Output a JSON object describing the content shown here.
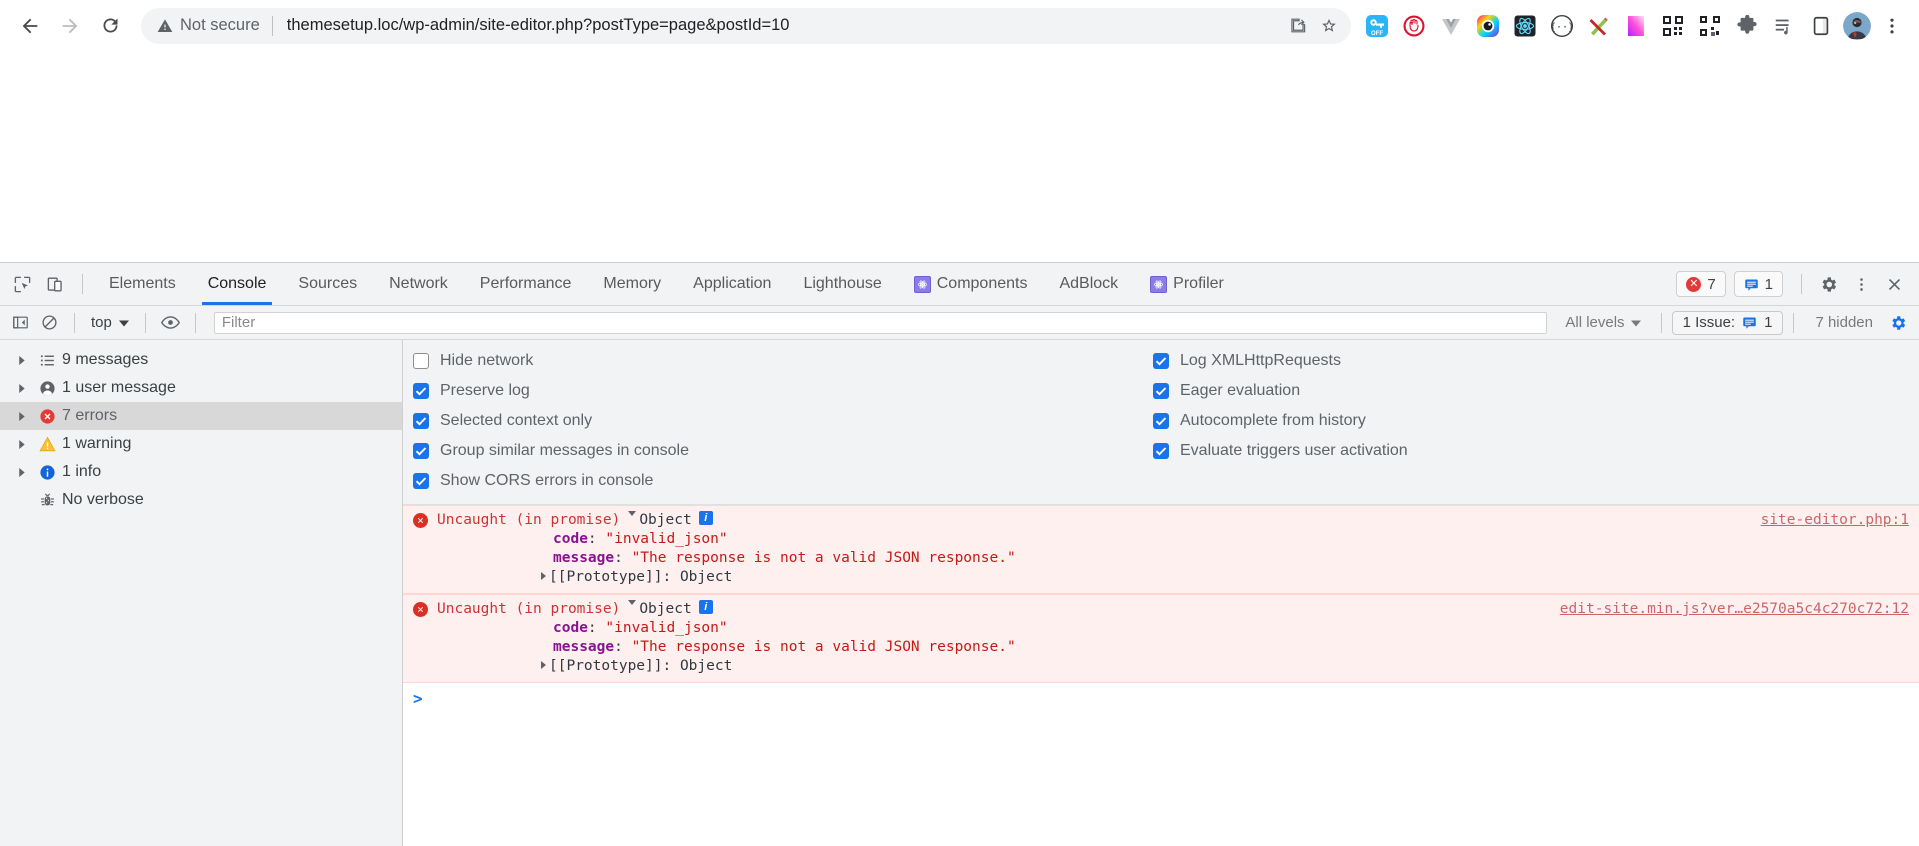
{
  "browser": {
    "back_label": "Back",
    "forward_label": "Forward",
    "reload_label": "Reload",
    "security_label": "Not secure",
    "url": "themesetup.loc/wp-admin/site-editor.php?postType=page&postId=10",
    "share_label": "Share this page",
    "bookmark_label": "Bookmark this tab",
    "menu_label": "Customize and control Google Chrome",
    "extensions": [
      {
        "name": "extension-icon-keyoff",
        "label": "OFF"
      },
      {
        "name": "extension-icon-adblock",
        "label": "AdBlock"
      },
      {
        "name": "extension-icon-vue-devtools",
        "label": "Vue.js devtools"
      },
      {
        "name": "extension-icon-colorpicker",
        "label": "ColorZilla"
      },
      {
        "name": "extension-icon-react-devtools",
        "label": "React Developer Tools"
      },
      {
        "name": "extension-icon-wappalyzer",
        "label": "Wappalyzer"
      },
      {
        "name": "extension-icon-xmarker",
        "label": "Marker"
      },
      {
        "name": "extension-icon-gradient",
        "label": "Gradient"
      },
      {
        "name": "extension-icon-qrcode",
        "label": "QR Code"
      },
      {
        "name": "extension-icon-qrscan",
        "label": "QR Scanner"
      },
      {
        "name": "extension-icon-puzzle",
        "label": "Extensions"
      },
      {
        "name": "extension-icon-playlist",
        "label": "Reading list"
      },
      {
        "name": "extension-icon-sidepanel",
        "label": "Side panel"
      }
    ]
  },
  "devtools": {
    "inspect_label": "Inspect element",
    "device_toolbar_label": "Toggle device toolbar",
    "tabs": [
      {
        "label": "Elements",
        "active": false,
        "icon": null
      },
      {
        "label": "Console",
        "active": true,
        "icon": null
      },
      {
        "label": "Sources",
        "active": false,
        "icon": null
      },
      {
        "label": "Network",
        "active": false,
        "icon": null
      },
      {
        "label": "Performance",
        "active": false,
        "icon": null
      },
      {
        "label": "Memory",
        "active": false,
        "icon": null
      },
      {
        "label": "Application",
        "active": false,
        "icon": null
      },
      {
        "label": "Lighthouse",
        "active": false,
        "icon": null
      },
      {
        "label": "Components",
        "active": false,
        "icon": "react-icon"
      },
      {
        "label": "AdBlock",
        "active": false,
        "icon": null
      },
      {
        "label": "Profiler",
        "active": false,
        "icon": "react-icon"
      }
    ],
    "error_count": "7",
    "message_count": "1",
    "settings_label": "Settings",
    "more_label": "More options",
    "close_label": "Close DevTools"
  },
  "console_toolbar": {
    "sidebar_toggle_label": "Show console sidebar",
    "clear_label": "Clear console",
    "context": "top",
    "live_expression_label": "Create live expression",
    "filter_placeholder": "Filter",
    "filter_value": "",
    "levels": "All levels",
    "issues_label": "1 Issue:",
    "issues_count": "1",
    "hidden_label": "7 hidden",
    "settings_label": "Console settings"
  },
  "sidebar": {
    "items": [
      {
        "label": "9 messages",
        "icon": "list-icon",
        "selected": false,
        "expandable": true
      },
      {
        "label": "1 user message",
        "icon": "user-icon",
        "selected": false,
        "expandable": true
      },
      {
        "label": "7 errors",
        "icon": "error-icon",
        "selected": true,
        "expandable": true
      },
      {
        "label": "1 warning",
        "icon": "warning-icon",
        "selected": false,
        "expandable": true
      },
      {
        "label": "1 info",
        "icon": "info-icon",
        "selected": false,
        "expandable": true
      },
      {
        "label": "No verbose",
        "icon": "bug-icon",
        "selected": false,
        "expandable": false
      }
    ]
  },
  "console_settings": {
    "left": [
      {
        "label": "Hide network",
        "checked": false
      },
      {
        "label": "Preserve log",
        "checked": true
      },
      {
        "label": "Selected context only",
        "checked": true
      },
      {
        "label": "Group similar messages in console",
        "checked": true
      },
      {
        "label": "Show CORS errors in console",
        "checked": true
      }
    ],
    "right": [
      {
        "label": "Log XMLHttpRequests",
        "checked": true
      },
      {
        "label": "Eager evaluation",
        "checked": true
      },
      {
        "label": "Autocomplete from history",
        "checked": true
      },
      {
        "label": "Evaluate triggers user activation",
        "checked": true
      }
    ]
  },
  "console_messages": [
    {
      "level": "error",
      "head": "Uncaught (in promise)",
      "object_label": "Object",
      "info_badge": "i",
      "props": [
        {
          "key": "code",
          "value": "\"invalid_json\""
        },
        {
          "key": "message",
          "value": "\"The response is not a valid JSON response.\""
        }
      ],
      "prototype": "[[Prototype]]: Object",
      "source": "site-editor.php:1"
    },
    {
      "level": "error",
      "head": "Uncaught (in promise)",
      "object_label": "Object",
      "info_badge": "i",
      "props": [
        {
          "key": "code",
          "value": "\"invalid_json\""
        },
        {
          "key": "message",
          "value": "\"The response is not a valid JSON response.\""
        }
      ],
      "prototype": "[[Prototype]]: Object",
      "source": "edit-site.min.js?ver…e2570a5c4c270c72:12"
    }
  ],
  "console_prompt": {
    "caret": ">",
    "value": ""
  },
  "colors": {
    "accent": "#1a73e8",
    "error": "#d93025",
    "warning": "#f9ab00",
    "info": "#1a73e8",
    "toolbar_bg": "#f1f3f4",
    "error_row_bg": "#fff0f0"
  }
}
